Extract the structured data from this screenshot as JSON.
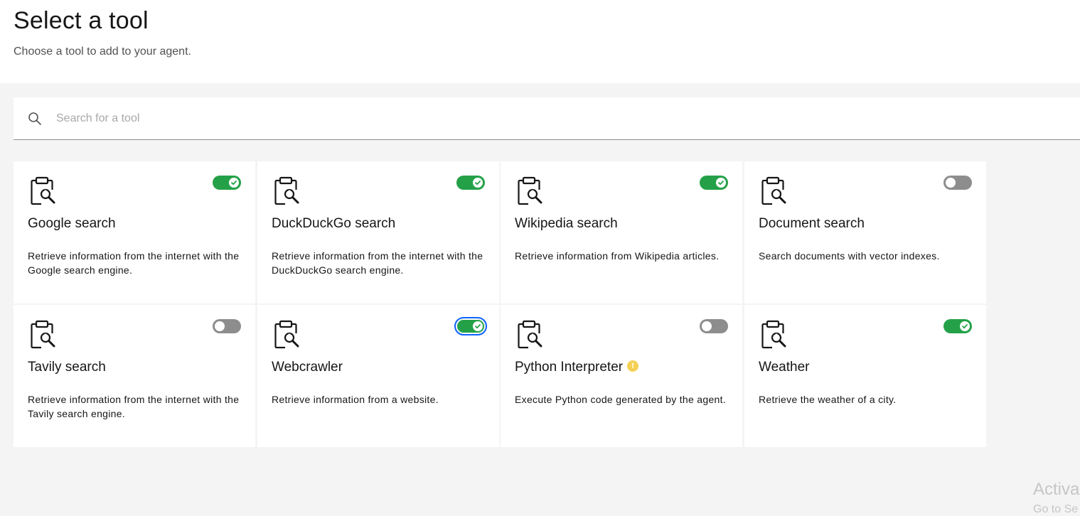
{
  "header": {
    "title": "Select a tool",
    "subtitle": "Choose a tool to add to your agent."
  },
  "search": {
    "placeholder": "Search for a tool",
    "value": ""
  },
  "tools": [
    {
      "title": "Google search",
      "description": "Retrieve information from the internet with the Google search engine.",
      "enabled": true,
      "icon": "clipboard-wrench-icon"
    },
    {
      "title": "DuckDuckGo search",
      "description": "Retrieve information from the internet with the DuckDuckGo search engine.",
      "enabled": true,
      "icon": "clipboard-wrench-icon"
    },
    {
      "title": "Wikipedia search",
      "description": "Retrieve information from Wikipedia articles.",
      "enabled": true,
      "icon": "clipboard-wrench-icon"
    },
    {
      "title": "Document search",
      "description": "Search documents with vector indexes.",
      "enabled": false,
      "icon": "clipboard-wrench-icon"
    },
    {
      "title": "Tavily search",
      "description": "Retrieve information from the internet with the Tavily search engine.",
      "enabled": false,
      "icon": "clipboard-wrench-icon"
    },
    {
      "title": "Webcrawler",
      "description": "Retrieve information from a website.",
      "enabled": true,
      "focused": true,
      "icon": "clipboard-wrench-icon"
    },
    {
      "title": "Python Interpreter",
      "description": "Execute Python code generated by the agent.",
      "enabled": false,
      "warning": true,
      "icon": "clipboard-wrench-icon"
    },
    {
      "title": "Weather",
      "description": "Retrieve the weather of a city.",
      "enabled": true,
      "icon": "clipboard-wrench-icon"
    }
  ],
  "colors": {
    "toggle_on": "#24a148",
    "toggle_off": "#8d8d8d",
    "focus": "#0f62fe",
    "warning": "#f1c21b"
  },
  "watermark": {
    "line1": "Activa",
    "line2": "Go to Se"
  }
}
